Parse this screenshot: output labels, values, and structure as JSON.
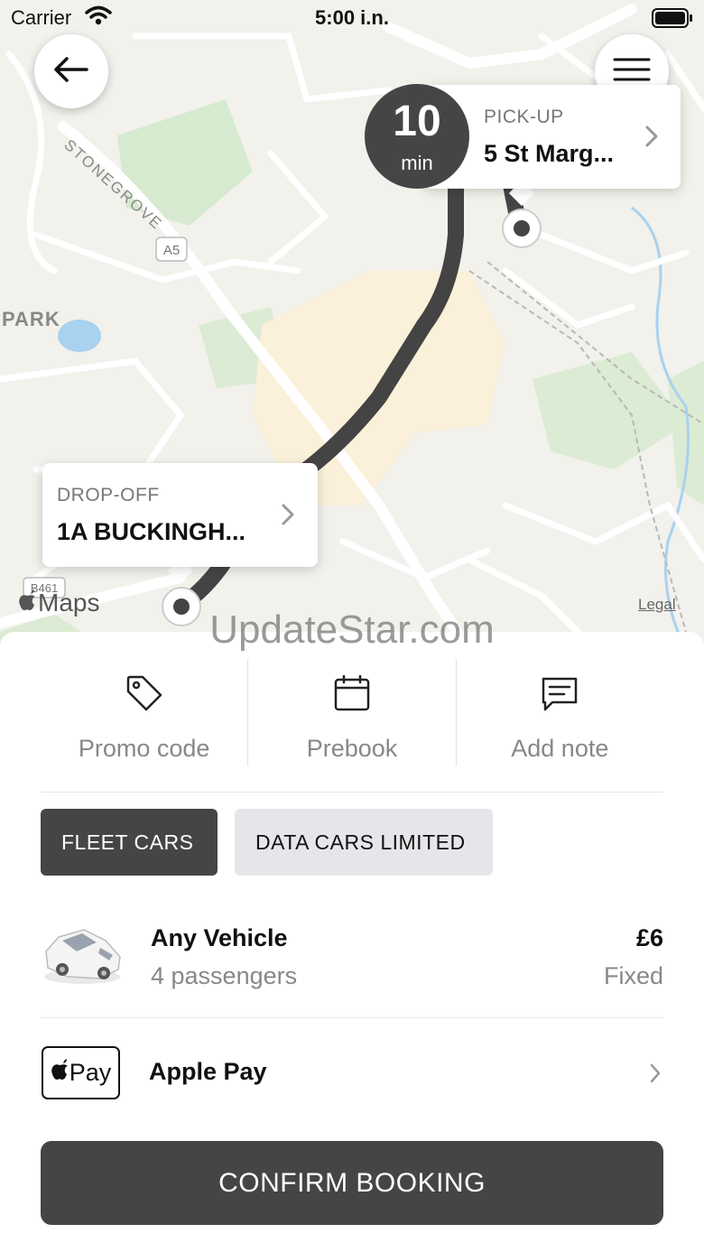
{
  "status_bar": {
    "carrier": "Carrier",
    "time": "5:00 i.n."
  },
  "map": {
    "labels": {
      "street": "STONEGROVE",
      "road_shield": "A5",
      "road_shield_2": "B461",
      "area": "PARK"
    },
    "eta": {
      "value": "10",
      "unit": "min"
    },
    "pickup": {
      "label": "PICK-UP",
      "address": "5 St Marg..."
    },
    "dropoff": {
      "label": "DROP-OFF",
      "address": "1A BUCKINGH..."
    },
    "attribution": "Maps",
    "legal": "Legal",
    "route_color": "#444444"
  },
  "watermark": "UpdateStar.com",
  "actions": [
    {
      "icon": "tag-icon",
      "label": "Promo code"
    },
    {
      "icon": "calendar-icon",
      "label": "Prebook"
    },
    {
      "icon": "note-icon",
      "label": "Add note"
    }
  ],
  "fleets": [
    {
      "label": "FLEET CARS",
      "selected": true
    },
    {
      "label": "DATA CARS LIMITED",
      "selected": false
    }
  ],
  "vehicle": {
    "name": "Any Vehicle",
    "passengers": "4 passengers",
    "price": "£6",
    "price_type": "Fixed"
  },
  "payment": {
    "badge": "Pay",
    "label": "Apple Pay"
  },
  "confirm": {
    "label": "CONFIRM BOOKING"
  },
  "colors": {
    "primary": "#454545",
    "secondary_chip": "#e6e6ea",
    "muted_text": "#888888"
  }
}
